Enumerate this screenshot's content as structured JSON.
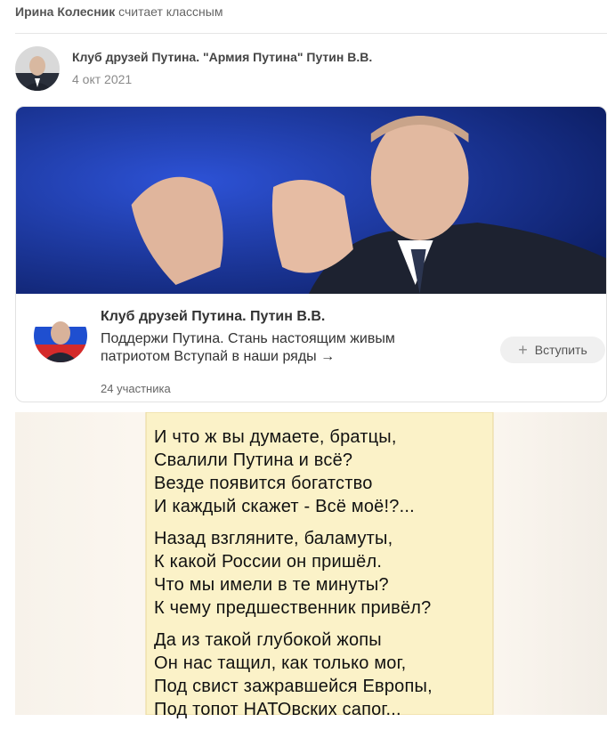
{
  "activity": {
    "user": "Ирина Колесник",
    "action": "считает классным"
  },
  "post": {
    "group": "Клуб друзей Путина. \"Армия Путина\" Путин В.В.",
    "date": "4 окт 2021"
  },
  "card": {
    "title": "Клуб друзей Путина. Путин В.В.",
    "description": "Поддержи Путина. Стань настоящим живым патриотом Вступай в наши ряды →",
    "members": "24 участника",
    "join_label": "Вступить"
  },
  "poem": {
    "stanzas": [
      [
        "И что ж вы думаете, братцы,",
        "Свалили Путина и всё?",
        "Везде появится богатство",
        "И каждый скажет - Всё моё!?..."
      ],
      [
        "Назад взгляните, баламуты,",
        "К какой России он пришёл.",
        "Что мы имели в те минуты?",
        "К чему предшественник привёл?"
      ],
      [
        "Да из такой глубокой жопы",
        "Он нас тащил, как только мог,",
        "Под свист зажравшейся Европы,",
        "Под топот НАТОвских сапог..."
      ]
    ]
  },
  "colors": {
    "banner_bg": "#1a3a9e",
    "poem_bg": "#fbf2c8"
  }
}
